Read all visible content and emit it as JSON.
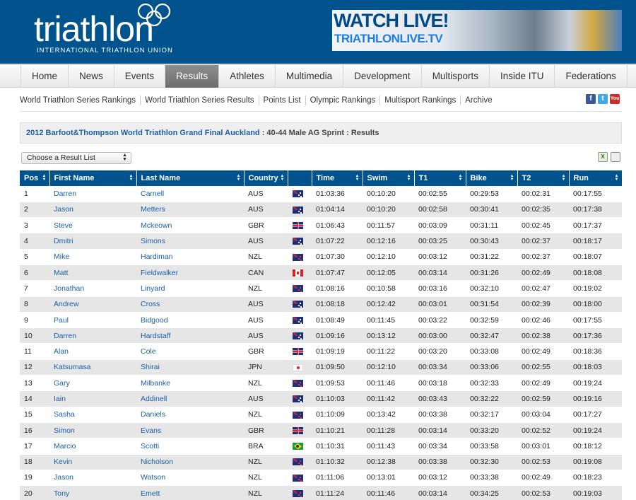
{
  "header": {
    "logo_word": "triathlon",
    "logo_subtitle": "INTERNATIONAL TRIATHLON UNION",
    "banner_title": "WATCH LIVE!",
    "banner_url": "TRIATHLONLIVE.TV"
  },
  "nav": {
    "items": [
      "Home",
      "News",
      "Events",
      "Results",
      "Athletes",
      "Multimedia",
      "Development",
      "Multisports",
      "Inside ITU",
      "Federations"
    ],
    "active": "Results"
  },
  "subnav": {
    "items": [
      "World Triathlon Series Rankings",
      "World Triathlon Series Results",
      "Points List",
      "Olympic Rankings",
      "Multisport Rankings",
      "Archive"
    ]
  },
  "social": {
    "facebook": "f",
    "twitter": "t",
    "youtube": "You"
  },
  "result_title": {
    "event": "2012 Barfoot&Thompson World Triathlon Grand Final Auckland",
    "category": " : 40-44 Male AG Sprint : Results"
  },
  "result_select": {
    "selected": "Choose a Result List"
  },
  "table": {
    "columns": [
      "Pos",
      "First Name",
      "Last Name",
      "Country",
      "",
      "Time",
      "Swim",
      "T1",
      "Bike",
      "T2",
      "Run"
    ],
    "rows": [
      [
        "1",
        "Darren",
        "Carnell",
        "AUS",
        "01:03:36",
        "00:10:20",
        "00:02:55",
        "00:29:53",
        "00:02:31",
        "00:17:55"
      ],
      [
        "2",
        "Jason",
        "Metters",
        "AUS",
        "01:04:14",
        "00:10:20",
        "00:02:58",
        "00:30:41",
        "00:02:35",
        "00:17:38"
      ],
      [
        "3",
        "Steve",
        "Mckeown",
        "GBR",
        "01:06:43",
        "00:11:57",
        "00:03:09",
        "00:31:11",
        "00:02:45",
        "00:17:37"
      ],
      [
        "4",
        "Dmitri",
        "Simons",
        "AUS",
        "01:07:22",
        "00:12:16",
        "00:03:25",
        "00:30:43",
        "00:02:37",
        "00:18:17"
      ],
      [
        "5",
        "Mike",
        "Hardiman",
        "NZL",
        "01:07:30",
        "00:12:10",
        "00:03:12",
        "00:31:22",
        "00:02:37",
        "00:18:07"
      ],
      [
        "6",
        "Matt",
        "Fieldwalker",
        "CAN",
        "01:07:47",
        "00:12:05",
        "00:03:14",
        "00:31:26",
        "00:02:49",
        "00:18:08"
      ],
      [
        "7",
        "Jonathan",
        "Linyard",
        "NZL",
        "01:08:16",
        "00:10:58",
        "00:03:16",
        "00:32:10",
        "00:02:47",
        "00:19:02"
      ],
      [
        "8",
        "Andrew",
        "Cross",
        "AUS",
        "01:08:18",
        "00:12:42",
        "00:03:01",
        "00:31:54",
        "00:02:39",
        "00:18:00"
      ],
      [
        "9",
        "Paul",
        "Bidgood",
        "AUS",
        "01:08:49",
        "00:11:45",
        "00:03:22",
        "00:32:59",
        "00:02:46",
        "00:17:55"
      ],
      [
        "10",
        "Darren",
        "Hardstaff",
        "AUS",
        "01:09:16",
        "00:13:12",
        "00:03:00",
        "00:32:47",
        "00:02:38",
        "00:17:36"
      ],
      [
        "11",
        "Alan",
        "Cole",
        "GBR",
        "01:09:19",
        "00:11:22",
        "00:03:20",
        "00:33:08",
        "00:02:49",
        "00:18:36"
      ],
      [
        "12",
        "Katsumasa",
        "Shirai",
        "JPN",
        "01:09:50",
        "00:12:10",
        "00:03:34",
        "00:33:06",
        "00:02:55",
        "00:18:03"
      ],
      [
        "13",
        "Gary",
        "Milbanke",
        "NZL",
        "01:09:53",
        "00:11:46",
        "00:03:18",
        "00:32:33",
        "00:02:49",
        "00:19:24"
      ],
      [
        "14",
        "Iain",
        "Addinell",
        "AUS",
        "01:10:03",
        "00:11:42",
        "00:03:43",
        "00:32:22",
        "00:02:59",
        "00:19:16"
      ],
      [
        "15",
        "Sasha",
        "Daniels",
        "NZL",
        "01:10:09",
        "00:13:42",
        "00:03:38",
        "00:32:17",
        "00:03:04",
        "00:17:27"
      ],
      [
        "16",
        "Simon",
        "Evans",
        "GBR",
        "01:10:21",
        "00:11:28",
        "00:03:14",
        "00:33:20",
        "00:02:52",
        "00:19:24"
      ],
      [
        "17",
        "Marcio",
        "Scotti",
        "BRA",
        "01:10:31",
        "00:11:43",
        "00:03:34",
        "00:33:58",
        "00:03:01",
        "00:18:12"
      ],
      [
        "18",
        "Kevin",
        "Nicholson",
        "NZL",
        "01:10:32",
        "00:12:38",
        "00:03:38",
        "00:32:30",
        "00:02:53",
        "00:19:08"
      ],
      [
        "19",
        "Jason",
        "Watson",
        "NZL",
        "01:11:06",
        "00:13:01",
        "00:03:12",
        "00:33:38",
        "00:02:49",
        "00:18:23"
      ],
      [
        "20",
        "Tony",
        "Emett",
        "NZL",
        "01:11:24",
        "00:11:46",
        "00:03:14",
        "00:34:25",
        "00:02:53",
        "00:19:03"
      ]
    ]
  },
  "colors": {
    "brand": "#00538d",
    "link": "#1a5fa8",
    "row_alt": "#e6e6e6",
    "nav_active": "#7a7a7a"
  }
}
